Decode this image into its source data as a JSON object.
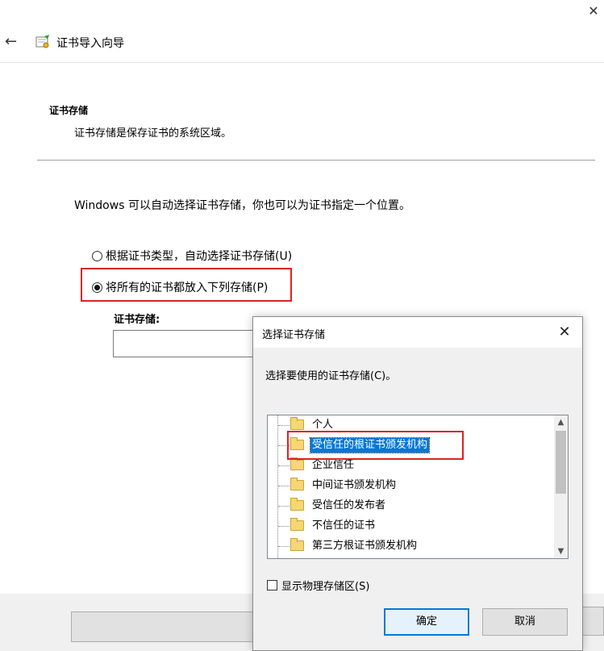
{
  "wizard": {
    "close_symbol": "✕",
    "back_symbol": "←",
    "title": "证书导入向导",
    "section_title": "证书存储",
    "section_desc": "证书存储是保存证书的系统区域。",
    "intro": "Windows 可以自动选择证书存储，你也可以为证书指定一个位置。",
    "radio_auto": "根据证书类型，自动选择证书存储(U)",
    "radio_manual": "将所有的证书都放入下列存储(P)",
    "radio_selected": "manual",
    "store_label": "证书存储:",
    "store_value": ""
  },
  "dialog": {
    "title": "选择证书存储",
    "close_symbol": "✕",
    "prompt": "选择要使用的证书存储(C)。",
    "tree_items": [
      {
        "label": "个人",
        "selected": false
      },
      {
        "label": "受信任的根证书颁发机构",
        "selected": true
      },
      {
        "label": "企业信任",
        "selected": false
      },
      {
        "label": "中间证书颁发机构",
        "selected": false
      },
      {
        "label": "受信任的发布者",
        "selected": false
      },
      {
        "label": "不信任的证书",
        "selected": false
      },
      {
        "label": "第三方根证书颁发机构",
        "selected": false
      }
    ],
    "scroll_up_symbol": "▲",
    "scroll_down_symbol": "▼",
    "show_physical": "显示物理存储区(S)",
    "show_physical_checked": false,
    "ok_label": "确定",
    "cancel_label": "取消"
  },
  "colors": {
    "highlight_border": "#dd2222",
    "selection": "#0078d7"
  },
  "icons": {
    "wizard": "certificate-wizard-icon",
    "tree_item": "folder-icon"
  }
}
